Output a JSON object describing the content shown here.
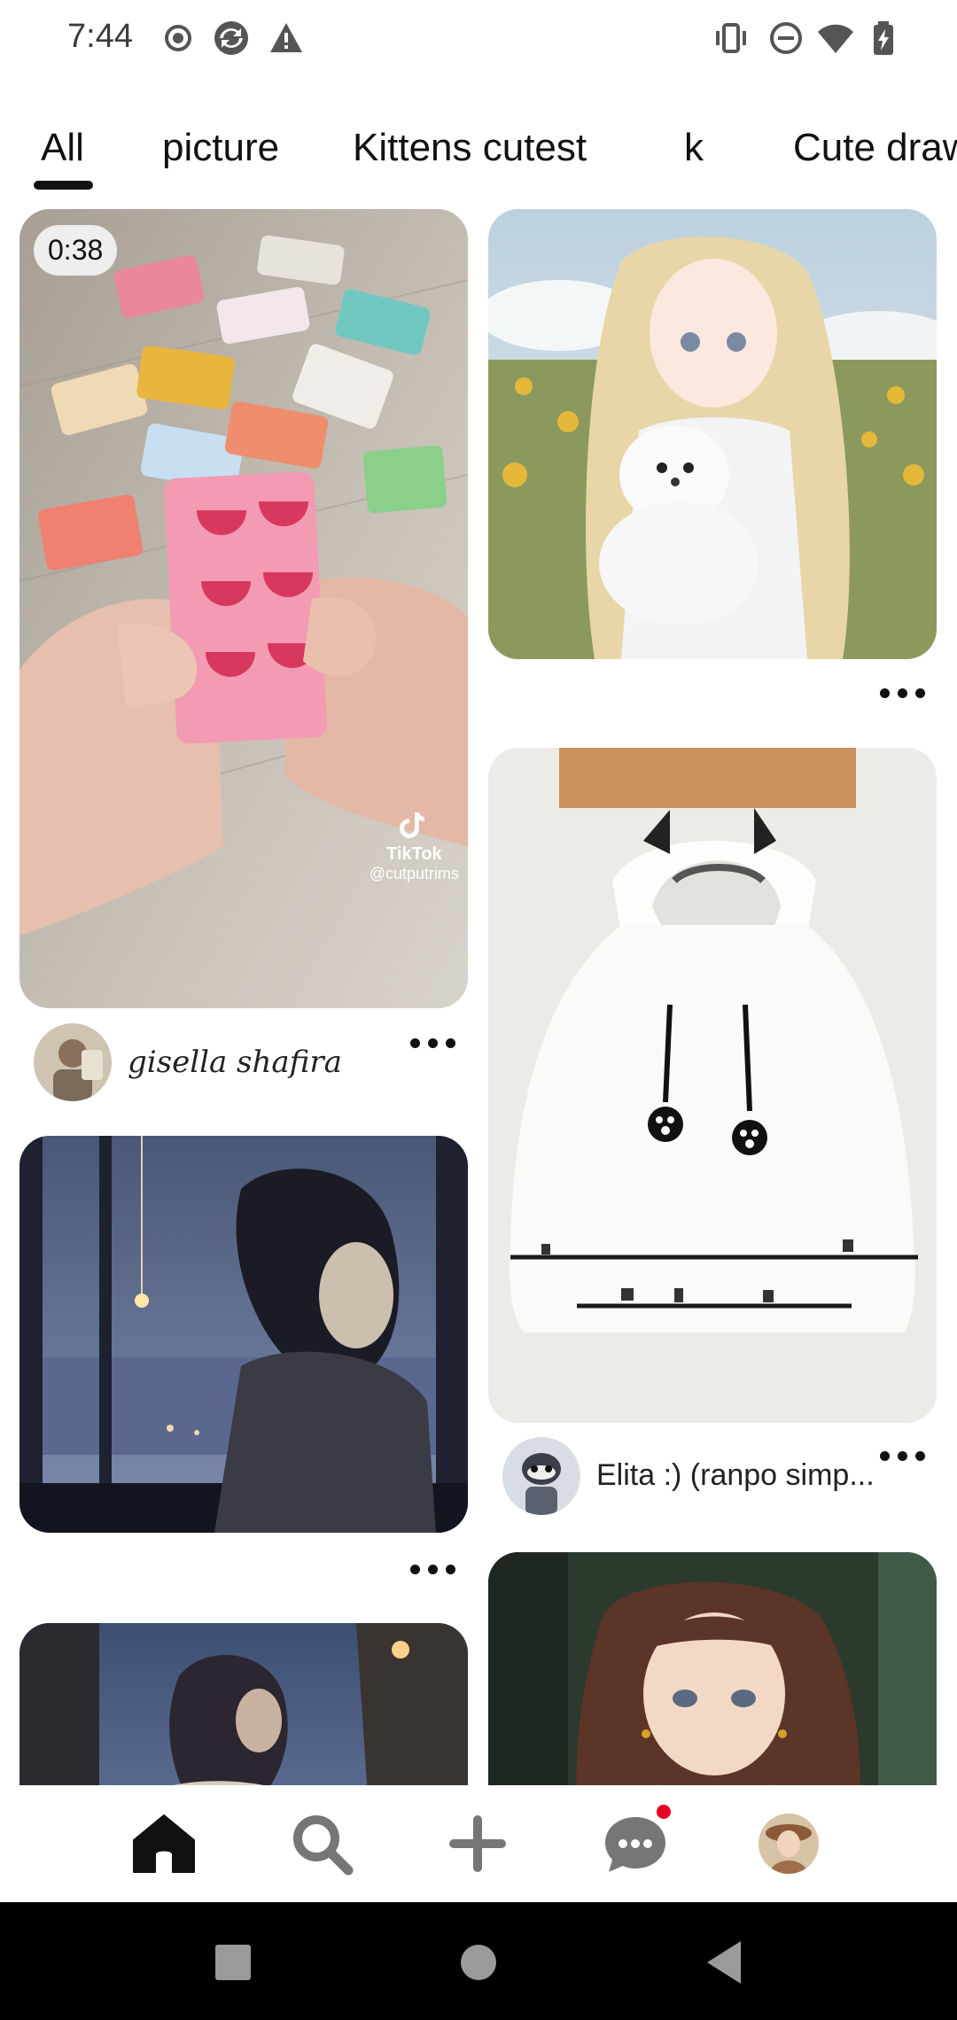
{
  "status_bar": {
    "time": "7:44",
    "left_icons": [
      "record-icon",
      "sync-app-icon",
      "warning-icon"
    ],
    "right_icons": [
      "vibrate-icon",
      "do-not-disturb-icon",
      "wifi-icon",
      "battery-charging-icon"
    ]
  },
  "tabs": [
    {
      "label": "All",
      "selected": true
    },
    {
      "label": "picture",
      "selected": false
    },
    {
      "label": "Kittens cutest",
      "selected": false
    },
    {
      "label": "k",
      "selected": false
    },
    {
      "label": "Cute draw",
      "selected": false
    }
  ],
  "pins": {
    "candy_video": {
      "duration": "0:38",
      "watermark": "TikTok",
      "watermark_handle": "@cutputrims",
      "author": "gisella shafira"
    },
    "anime_girl_dog": {},
    "anime_night_window": {},
    "cat_hoodie": {
      "author": "Elita :) (ranpo simp..."
    },
    "anime_girl_night_sky": {},
    "anime_brunette": {}
  },
  "bottom_nav": {
    "items": [
      "home-icon",
      "search-icon",
      "create-icon",
      "messages-icon",
      "profile-avatar"
    ],
    "active": "home",
    "messages_has_notification": true
  },
  "colors": {
    "accent": "#e60023",
    "text": "#111111",
    "background": "#ffffff"
  }
}
